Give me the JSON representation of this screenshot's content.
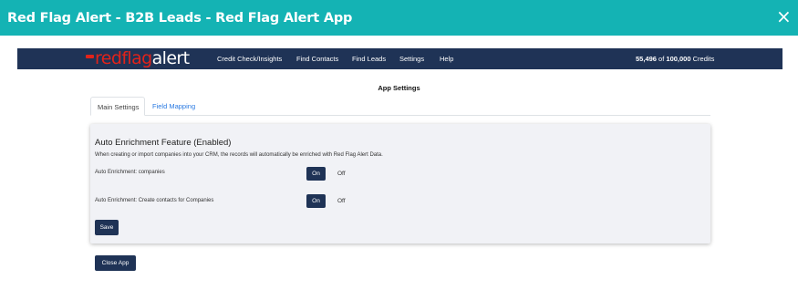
{
  "modal": {
    "title": "Red Flag Alert - B2B Leads - Red Flag Alert App",
    "close_glyph": "×"
  },
  "navbar": {
    "logo_red": "redflag",
    "logo_white": "alert",
    "items": [
      {
        "label": "Credit Check/Insights"
      },
      {
        "label": "Find Contacts"
      },
      {
        "label": "Find Leads"
      },
      {
        "label": "Settings"
      },
      {
        "label": "Help"
      }
    ],
    "credits": {
      "used": "55,496",
      "of": "of",
      "total": "100,000",
      "suffix": "Credits"
    }
  },
  "page": {
    "title": "App Settings"
  },
  "tabs": [
    {
      "label": "Main Settings",
      "active": true
    },
    {
      "label": "Field Mapping",
      "active": false
    }
  ],
  "card": {
    "title": "Auto Enrichment Feature (Enabled)",
    "description": "When creating or import companies into your CRM, the records will automatically be enriched with Red Flag Alert Data.",
    "rows": [
      {
        "label": "Auto Enrichment: companies",
        "on_label": "On",
        "off_label": "Off",
        "value": "On"
      },
      {
        "label": "Auto Enrichment: Create contacts for Companies",
        "on_label": "On",
        "off_label": "Off",
        "value": "On"
      }
    ],
    "save_label": "Save"
  },
  "footer": {
    "close_app_label": "Close App"
  },
  "colors": {
    "header_teal": "#14b3b4",
    "navy": "#1f3356",
    "brand_red": "#e2231a",
    "link_blue": "#2a7ae2"
  }
}
